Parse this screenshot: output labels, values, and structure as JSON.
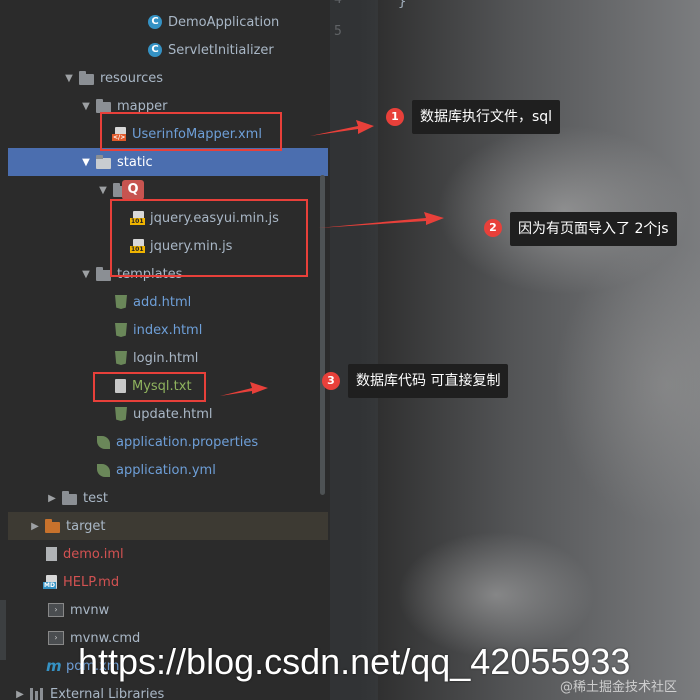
{
  "editor": {
    "line_numbers": [
      "4",
      "5"
    ],
    "code_line": "}"
  },
  "project_tree": {
    "items": [
      {
        "label": "DemoApplication",
        "icon": "java-class-icon"
      },
      {
        "label": "ServletInitializer",
        "icon": "java-class-icon"
      },
      {
        "label": "resources",
        "icon": "folder-icon"
      },
      {
        "label": "mapper",
        "icon": "folder-icon"
      },
      {
        "label": "UserinfoMapper.xml",
        "icon": "xml-file-icon"
      },
      {
        "label": "static",
        "icon": "folder-icon"
      },
      {
        "label": "jquery.easyui.min.js",
        "icon": "js-file-icon"
      },
      {
        "label": "jquery.min.js",
        "icon": "js-file-icon"
      },
      {
        "label": "templates",
        "icon": "folder-icon"
      },
      {
        "label": "add.html",
        "icon": "html-file-icon"
      },
      {
        "label": "index.html",
        "icon": "html-file-icon"
      },
      {
        "label": "login.html",
        "icon": "html-file-icon"
      },
      {
        "label": "Mysql.txt",
        "icon": "text-file-icon"
      },
      {
        "label": "update.html",
        "icon": "html-file-icon"
      },
      {
        "label": "application.properties",
        "icon": "spring-config-icon"
      },
      {
        "label": "application.yml",
        "icon": "spring-config-icon"
      },
      {
        "label": "test",
        "icon": "folder-icon"
      },
      {
        "label": "target",
        "icon": "folder-icon"
      },
      {
        "label": "demo.iml",
        "icon": "iml-file-icon"
      },
      {
        "label": "HELP.md",
        "icon": "markdown-file-icon"
      },
      {
        "label": "mvnw",
        "icon": "shell-file-icon"
      },
      {
        "label": "mvnw.cmd",
        "icon": "shell-file-icon"
      },
      {
        "label": "pom.xml",
        "icon": "maven-icon"
      },
      {
        "label": "External Libraries",
        "icon": "libraries-icon"
      }
    ],
    "js_tag": "101"
  },
  "annotations": [
    {
      "number": "1",
      "text": "数据库执行文件，sql"
    },
    {
      "number": "2",
      "text": "因为有页面导入了 2个js"
    },
    {
      "number": "3",
      "text": "数据库代码 可直接复制"
    }
  ],
  "watermark": {
    "url": "https://blog.csdn.net/qq_42055933",
    "juejin": "@稀土掘金技术社区"
  },
  "colors": {
    "selection": "#4b6eaf",
    "annotation_red": "#e8403a",
    "note_bg": "#1f1f1f"
  }
}
